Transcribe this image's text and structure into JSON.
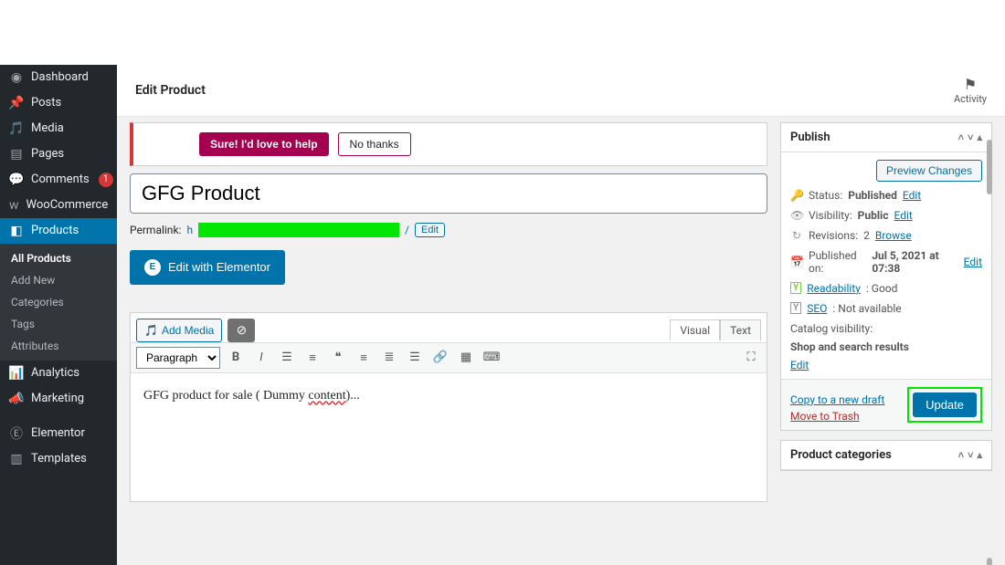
{
  "sidebar": {
    "items": [
      {
        "label": "Dashboard"
      },
      {
        "label": "Posts"
      },
      {
        "label": "Media"
      },
      {
        "label": "Pages"
      },
      {
        "label": "Comments",
        "badge": "1"
      },
      {
        "label": "WooCommerce"
      },
      {
        "label": "Products"
      },
      {
        "label": "Analytics"
      },
      {
        "label": "Marketing"
      },
      {
        "label": "Elementor"
      },
      {
        "label": "Templates"
      }
    ],
    "sub": [
      {
        "label": "All Products"
      },
      {
        "label": "Add New"
      },
      {
        "label": "Categories"
      },
      {
        "label": "Tags"
      },
      {
        "label": "Attributes"
      }
    ]
  },
  "topbar": {
    "title": "Edit Product",
    "activity": "Activity"
  },
  "notice": {
    "accept": "Sure! I'd love to help",
    "decline": "No thanks"
  },
  "product": {
    "title": "GFG Product",
    "permalink_label": "Permalink:",
    "url_prefix": "h",
    "url_suffix": "/",
    "edit": "Edit"
  },
  "elementor_button": "Edit with Elementor",
  "editor": {
    "add_media": "Add Media",
    "tabs": {
      "visual": "Visual",
      "text": "Text"
    },
    "format": "Paragraph",
    "content_pre": "GFG product for sale ( Dummy ",
    "content_spell": "content",
    "content_post": ")..."
  },
  "publish": {
    "title": "Publish",
    "preview": "Preview Changes",
    "status_label": "Status:",
    "status_value": "Published",
    "edit": "Edit",
    "visibility_label": "Visibility:",
    "visibility_value": "Public",
    "revisions_label": "Revisions:",
    "revisions_value": "2",
    "revisions_browse": "Browse",
    "published_label": "Published on:",
    "published_value": "Jul 5, 2021 at 07:38",
    "readability_label": "Readability",
    "readability_value": ": Good",
    "seo_label": "SEO",
    "seo_value": ": Not available",
    "catalog_label": "Catalog visibility:",
    "catalog_value": "Shop and search results",
    "copy": "Copy to a new draft",
    "trash": "Move to Trash",
    "update": "Update"
  },
  "next_panel": "Product categories"
}
